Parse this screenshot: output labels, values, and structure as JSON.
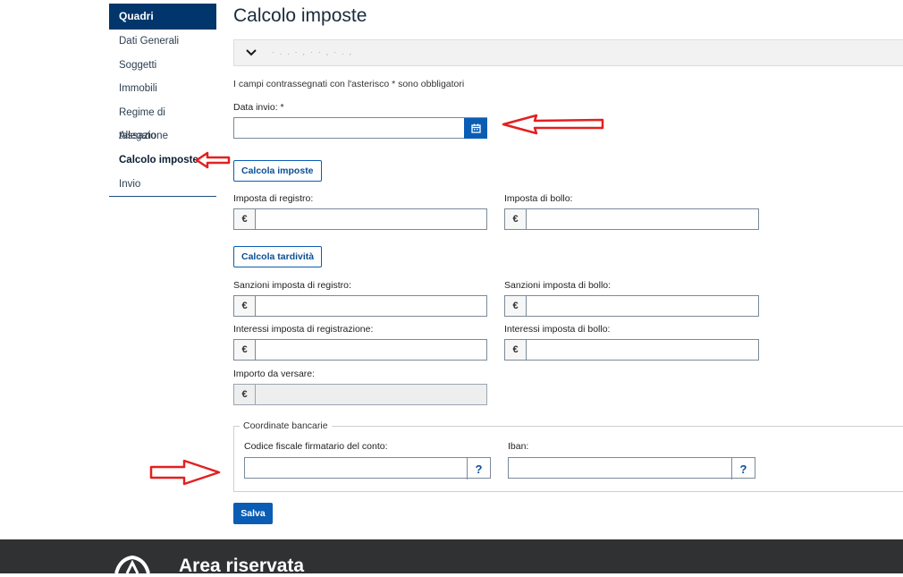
{
  "sidebar": {
    "header": "Quadri",
    "items": [
      {
        "label": "Dati Generali"
      },
      {
        "label": "Soggetti"
      },
      {
        "label": "Immobili"
      },
      {
        "label": "Regime di tassazione"
      },
      {
        "label": "Allegato"
      },
      {
        "label": "Calcolo imposte"
      },
      {
        "label": "Invio"
      }
    ],
    "active_index": 5
  },
  "main": {
    "title": "Calcolo imposte",
    "required_note": "I campi contrassegnati con l'asterisco * sono obbligatori",
    "data_invio": {
      "label": "Data invio: *",
      "value": ""
    },
    "calcola_imposte_label": "Calcola imposte",
    "imposta_registro": {
      "label": "Imposta di registro:",
      "currency": "€",
      "value": ""
    },
    "imposta_bollo": {
      "label": "Imposta di bollo:",
      "currency": "€",
      "value": ""
    },
    "calcola_tardivita_label": "Calcola tardività",
    "sanzioni_registro": {
      "label": "Sanzioni imposta di registro:",
      "currency": "€",
      "value": ""
    },
    "sanzioni_bollo": {
      "label": "Sanzioni imposta di bollo:",
      "currency": "€",
      "value": ""
    },
    "interessi_registrazione": {
      "label": "Interessi imposta di registrazione:",
      "currency": "€",
      "value": ""
    },
    "interessi_bollo": {
      "label": "Interessi imposta di bollo:",
      "currency": "€",
      "value": ""
    },
    "importo_versare": {
      "label": "Importo da versare:",
      "currency": "€",
      "value": ""
    },
    "coordinate": {
      "legend": "Coordinate bancarie",
      "codice_fiscale": {
        "label": "Codice fiscale firmatario del conto:",
        "value": "",
        "help": "?"
      },
      "iban": {
        "label": "Iban:",
        "value": "",
        "help": "?"
      }
    },
    "salva_label": "Salva"
  },
  "footer": {
    "title": "Area riservata"
  },
  "colors": {
    "primary": "#0a5db4",
    "sidebar_header": "#00366b",
    "footer_bg": "#2f3133",
    "annotation": "#e32020"
  }
}
